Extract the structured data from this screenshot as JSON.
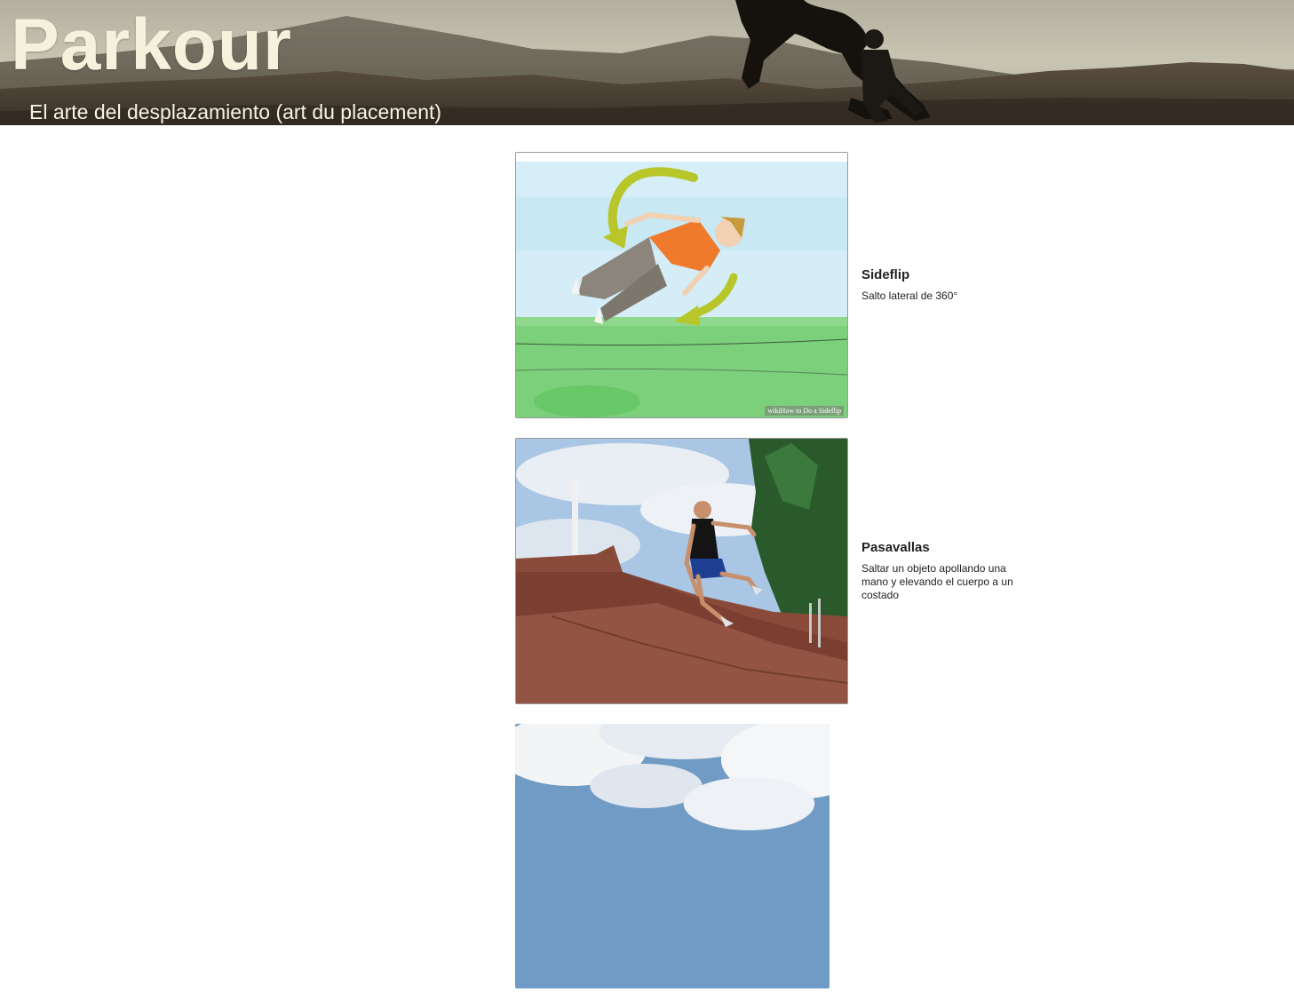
{
  "header": {
    "title": "Parkour",
    "subtitle": "El arte del desplazamiento (art du placement)"
  },
  "moves": [
    {
      "name": "Sideflip",
      "description": "Salto lateral de 360°",
      "image_watermark": "wikiHow to Do a Sideflip"
    },
    {
      "name": "Pasavallas",
      "description": "Saltar un objeto apollando una mano y elevando el cuerpo a un costado"
    },
    {
      "name": "",
      "description": ""
    }
  ],
  "colors": {
    "title_text": "#f4f2dc",
    "body_text": "#222222",
    "image_border": "#9a9a9a"
  }
}
